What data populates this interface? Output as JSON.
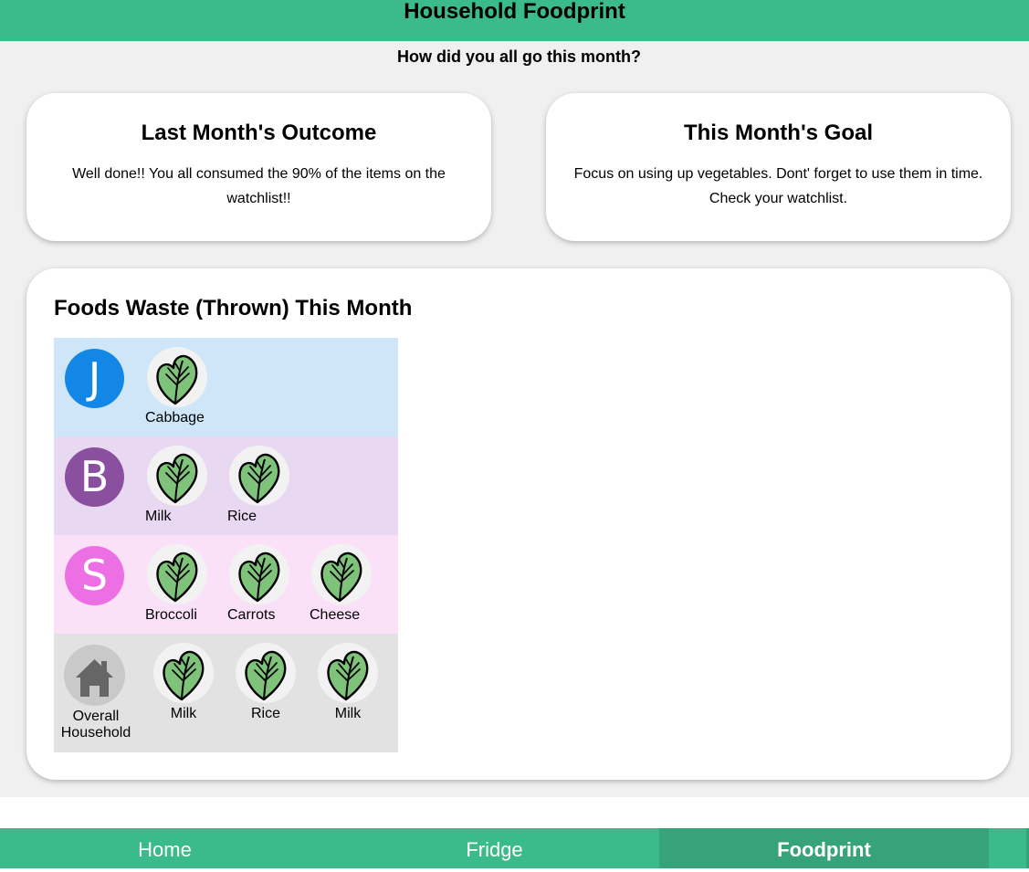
{
  "header": {
    "title": "Household Foodprint"
  },
  "subtitle": "How did you all go this month?",
  "outcome": {
    "title": "Last Month's Outcome",
    "text": "Well done!! You all consumed the 90% of the items on the watchlist!!"
  },
  "goal": {
    "title": "This Month's Goal",
    "text": "Focus on using up vegetables. Dont' forget to use them in time. Check your watchlist."
  },
  "waste": {
    "title": "Foods Waste (Thrown) This Month",
    "members": [
      {
        "initial": "J",
        "color": "#1487e6",
        "bg": "#cfe6f9",
        "items": [
          "Cabbage"
        ]
      },
      {
        "initial": "B",
        "color": "#8a4f9e",
        "bg": "#e8d8f2",
        "items": [
          "Milk",
          "Rice"
        ]
      },
      {
        "initial": "S",
        "color": "#ec6fe3",
        "bg": "#fbe1f8",
        "items": [
          "Broccoli",
          "Carrots",
          "Cheese"
        ]
      }
    ],
    "household": {
      "label": "Overall Household",
      "icon": "house-icon",
      "bg": "#e2e2e2",
      "items": [
        "Milk",
        "Rice",
        "Milk"
      ]
    },
    "item_icon": "spinach-leaf-icon"
  },
  "nav": {
    "tabs": [
      "Home",
      "Fridge",
      "Foodprint"
    ],
    "active": "Foodprint"
  }
}
